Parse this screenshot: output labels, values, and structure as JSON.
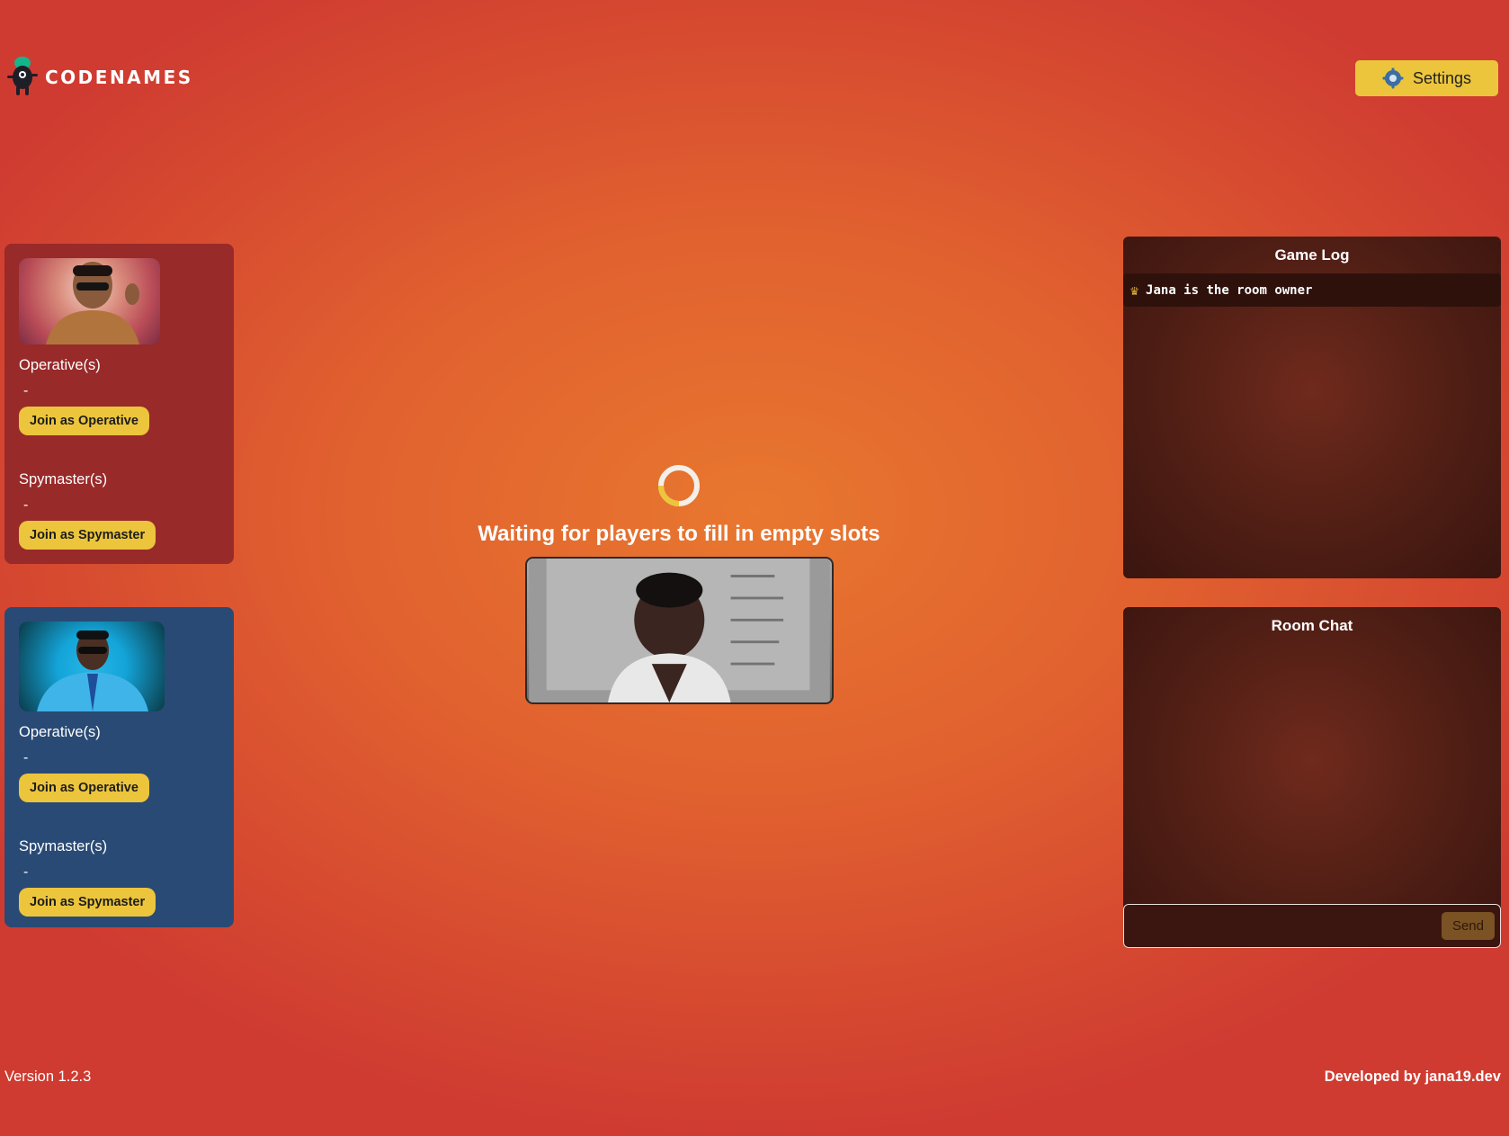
{
  "header": {
    "logo_text": "CODENAMES",
    "logo_icon": "spy-mascot-icon",
    "settings_label": "Settings",
    "settings_icon": "gear-icon"
  },
  "teams": {
    "red": {
      "operatives_label": "Operative(s)",
      "operatives_value": "-",
      "join_operative_label": "Join as Operative",
      "spymasters_label": "Spymaster(s)",
      "spymasters_value": "-",
      "join_spymaster_label": "Join as Spymaster",
      "color": "#982a2a"
    },
    "blue": {
      "operatives_label": "Operative(s)",
      "operatives_value": "-",
      "join_operative_label": "Join as Operative",
      "spymasters_label": "Spymaster(s)",
      "spymasters_value": "-",
      "join_spymaster_label": "Join as Spymaster",
      "color": "#294a74"
    }
  },
  "center": {
    "waiting_text": "Waiting for players to fill in empty slots"
  },
  "game_log": {
    "title": "Game Log",
    "entries": [
      {
        "icon": "crown-icon",
        "text": "Jana is the room owner"
      }
    ]
  },
  "room_chat": {
    "title": "Room Chat",
    "input_value": "",
    "send_label": "Send"
  },
  "footer": {
    "version": "Version 1.2.3",
    "developer": "Developed by jana19.dev"
  },
  "colors": {
    "accent": "#ecc53c",
    "background": "#e1612f"
  }
}
